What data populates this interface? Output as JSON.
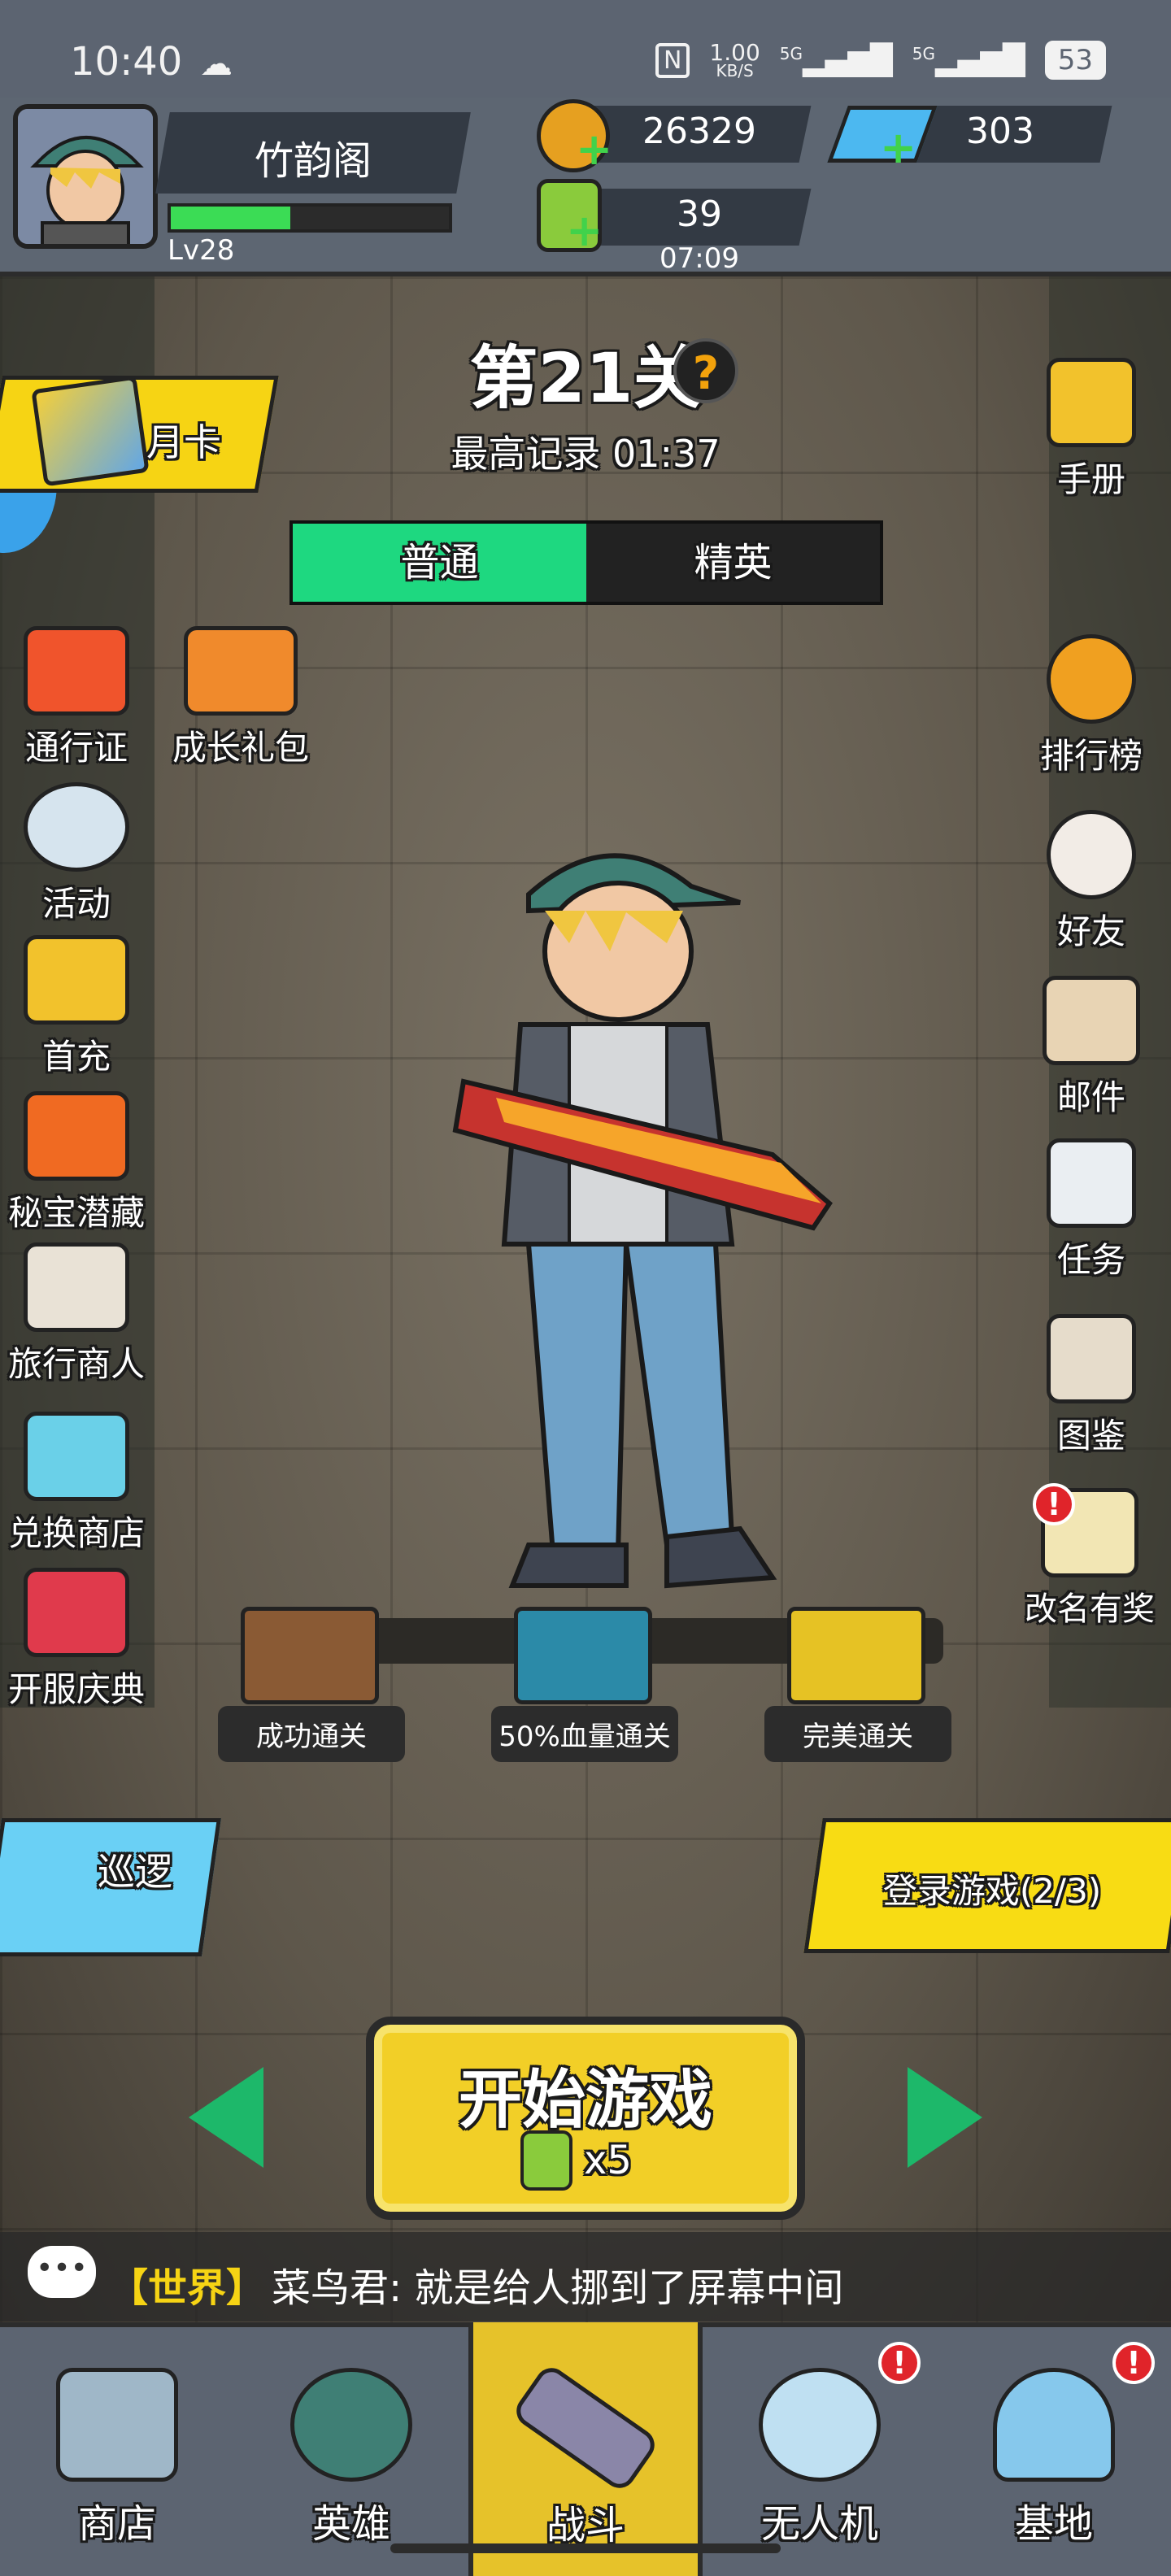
{
  "status_bar": {
    "time": "10:40",
    "network_speed_value": "1.00",
    "network_speed_unit": "KB/S",
    "signal_1": "5G",
    "signal_2": "5G",
    "battery": "53"
  },
  "player": {
    "name": "竹韵阁",
    "level": "Lv28",
    "xp_fraction": 0.43
  },
  "resources": {
    "coins": "26329",
    "gems": "303",
    "energy": "39",
    "energy_timer": "07:09"
  },
  "stage": {
    "title": "第21关",
    "help_symbol": "?",
    "best_record": "最高记录 01:37",
    "modes": [
      {
        "label": "普通",
        "active": true
      },
      {
        "label": "精英",
        "active": false
      }
    ]
  },
  "left_menu": {
    "monthly_card": "月卡",
    "items": [
      {
        "label": "通行证"
      },
      {
        "label": "成长礼包"
      },
      {
        "label": "活动"
      },
      {
        "label": "首充"
      },
      {
        "label": "秘宝潜藏"
      },
      {
        "label": "旅行商人"
      },
      {
        "label": "兑换商店"
      },
      {
        "label": "开服庆典"
      }
    ],
    "patrol": "巡逻"
  },
  "right_menu": {
    "items": [
      {
        "label": "手册"
      },
      {
        "label": "排行榜"
      },
      {
        "label": "好友"
      },
      {
        "label": "邮件"
      },
      {
        "label": "任务"
      },
      {
        "label": "图鉴"
      },
      {
        "label": "改名有奖"
      }
    ],
    "alert_symbol": "!",
    "login_progress": "登录游戏(2/3)"
  },
  "rewards": [
    {
      "label": "成功通关",
      "color": "#8a5a34"
    },
    {
      "label": "50%血量通关",
      "color": "#2b8aa8"
    },
    {
      "label": "完美通关",
      "color": "#e6c224"
    }
  ],
  "start": {
    "label": "开始游戏",
    "cost": "x5"
  },
  "chat": {
    "icon_text": "•••",
    "channel": "【世界】",
    "message": "菜鸟君: 就是给人挪到了屏幕中间"
  },
  "nav": {
    "items": [
      {
        "label": "商店",
        "badge": false
      },
      {
        "label": "英雄",
        "badge": false
      },
      {
        "label": "战斗",
        "badge": false,
        "active": true
      },
      {
        "label": "无人机",
        "badge": true
      },
      {
        "label": "基地",
        "badge": true
      }
    ],
    "badge_symbol": "!"
  },
  "colors": {
    "accent_green": "#1ed880",
    "gold": "#f6d414",
    "panel": "#5c6471",
    "alert_red": "#e0242a"
  }
}
